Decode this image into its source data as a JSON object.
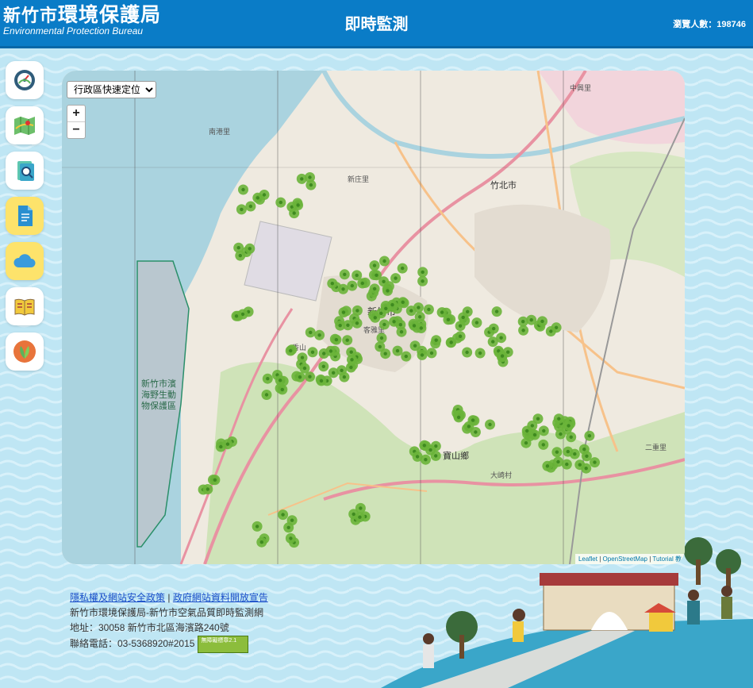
{
  "header": {
    "logo_city": "新竹市",
    "logo_org": "環境保護局",
    "logo_en": "Environmental Protection Bureau",
    "title": "即時監測",
    "visitors_label": "瀏覽人數：",
    "visitors_count": "198746"
  },
  "sidebar": {
    "items": [
      {
        "icon": "gauge-icon"
      },
      {
        "icon": "map-icon"
      },
      {
        "icon": "search-document-icon"
      },
      {
        "icon": "document-icon"
      },
      {
        "icon": "cloud-icon"
      },
      {
        "icon": "book-icon"
      },
      {
        "icon": "leaf-icon"
      }
    ]
  },
  "map": {
    "district_select": "行政區快速定位",
    "zoom_in": "+",
    "zoom_out": "−",
    "attribution_leaflet": "Leaflet",
    "attribution_osm": "OpenStreetMap",
    "attribution_tutorial": "Tutorial 教",
    "place_labels": [
      "新竹市濱海野生動物保護區",
      "竹北市",
      "新竹市",
      "寶山鄉",
      "香山",
      "客雅里",
      "二重里",
      "大崎村",
      "南港里",
      "中興里",
      "新庄里"
    ],
    "marker_color": "#6ab43a"
  },
  "footer": {
    "privacy_link": "隱私權及網站安全政策",
    "separator": "|",
    "open_data_link": "政府網站資料開放宣告",
    "org_line": "新竹市環境保護局-新竹市空氣品質即時監測網",
    "address": "地址：30058 新竹市北區海濱路240號",
    "phone": "聯絡電話：03-5368920#2015",
    "accessibility_badge": "無障礙標章2.1"
  },
  "colors": {
    "header_bg": "#0a7cc7",
    "page_bg": "#bfe6f4",
    "side_highlight": "#fde36b"
  }
}
